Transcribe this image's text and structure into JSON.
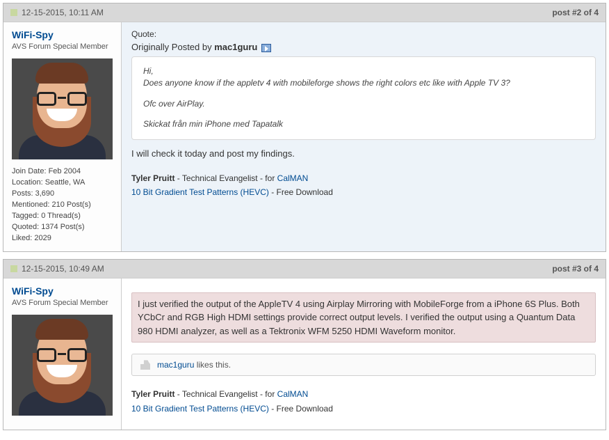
{
  "posts": [
    {
      "date": "12-15-2015, 10:11 AM",
      "badge": "post #2 of 4",
      "user": {
        "name": "WiFi-Spy",
        "rank": "AVS Forum Special Member",
        "stats": {
          "join": "Join Date: Feb 2004",
          "loc": "Location: Seattle, WA",
          "posts": "Posts: 3,690",
          "mentioned": "Mentioned: 210 Post(s)",
          "tagged": "Tagged: 0 Thread(s)",
          "quoted": "Quoted: 1374 Post(s)",
          "liked": "Liked: 2029"
        }
      },
      "quote": {
        "label": "Quote:",
        "origin_prefix": "Originally Posted by ",
        "origin_user": "mac1guru",
        "lines": [
          "Hi,",
          "Does anyone know if the appletv 4 with mobileforge shows the right colors etc like with Apple TV 3?",
          "Ofc over AirPlay.",
          "Skickat från min iPhone med Tapatalk"
        ]
      },
      "reply": "I will check it today and post my findings.",
      "sig": {
        "name": "Tyler Pruitt",
        "role": " - Technical Evangelist - for ",
        "link1": "CalMAN",
        "link2": "10 Bit Gradient Test Patterns (HEVC)",
        "tail": " - Free Download"
      }
    },
    {
      "date": "12-15-2015, 10:49 AM",
      "badge": "post #3 of 4",
      "user": {
        "name": "WiFi-Spy",
        "rank": "AVS Forum Special Member"
      },
      "reply": "I just verified the output of the AppleTV 4 using Airplay Mirroring with MobileForge from a iPhone 6S Plus. Both YCbCr and RGB High HDMI settings provide correct output levels. I verified the output using a Quantum Data 980 HDMI analyzer, as well as a Tektronix WFM 5250 HDMI Waveform monitor.",
      "likes": {
        "user": "mac1guru",
        "text": " likes this."
      },
      "sig": {
        "name": "Tyler Pruitt",
        "role": " - Technical Evangelist - for ",
        "link1": "CalMAN",
        "link2": "10 Bit Gradient Test Patterns (HEVC)",
        "tail": " - Free Download"
      }
    }
  ]
}
